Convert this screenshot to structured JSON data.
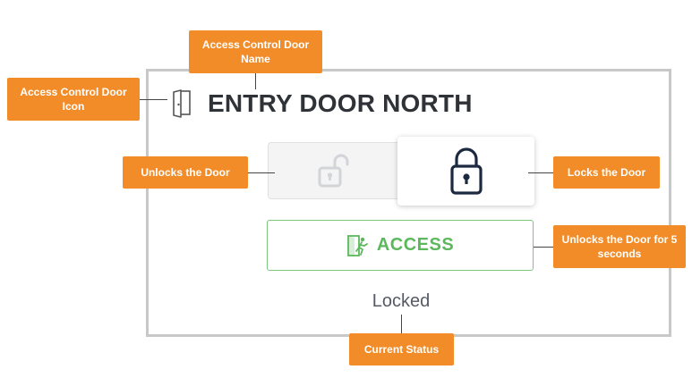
{
  "door": {
    "name": "ENTRY DOOR NORTH",
    "icon": "door-icon"
  },
  "controls": {
    "unlock_icon": "unlocked-padlock-icon",
    "lock_icon": "locked-padlock-icon",
    "access_label": "ACCESS",
    "access_icon": "door-exit-running-person-icon"
  },
  "status": {
    "text": "Locked"
  },
  "callouts": {
    "door_name": "Access Control Door Name",
    "door_icon": "Access Control Door Icon",
    "unlock": "Unlocks the Door",
    "lock": "Locks the Door",
    "access": "Unlocks the Door for 5 seconds",
    "status": "Current Status"
  },
  "colors": {
    "callout": "#f28c28",
    "access_green": "#5cb85c",
    "door_name_text": "#2f3338"
  }
}
